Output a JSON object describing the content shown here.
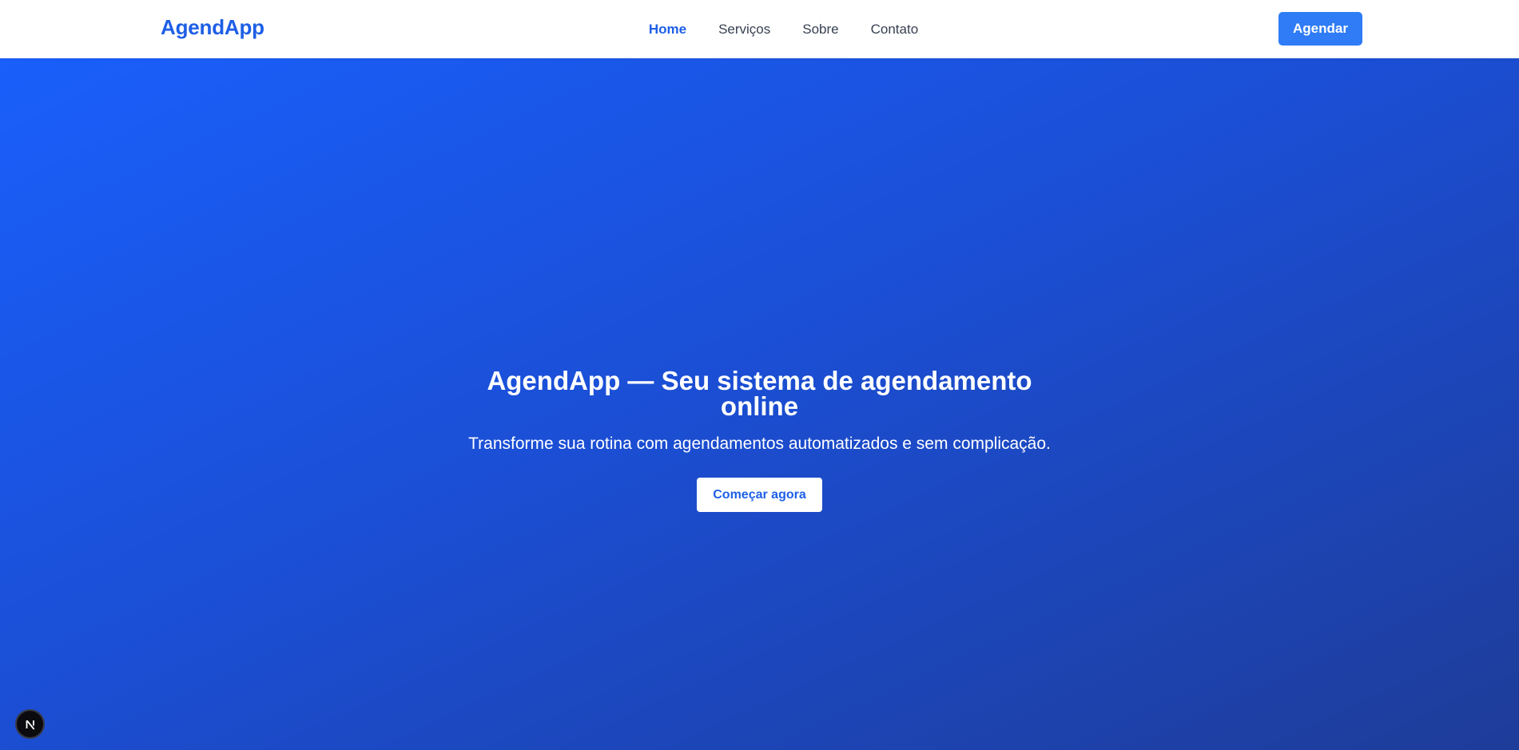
{
  "header": {
    "logo": "AgendApp",
    "nav": [
      {
        "label": "Home",
        "active": true
      },
      {
        "label": "Serviços",
        "active": false
      },
      {
        "label": "Sobre",
        "active": false
      },
      {
        "label": "Contato",
        "active": false
      }
    ],
    "cta_label": "Agendar"
  },
  "hero": {
    "title_line1": "AgendApp — Seu sistema de agendamento",
    "title_line2": "online",
    "subtitle": "Transforme sua rotina com agendamentos automatizados e sem complicação.",
    "button_label": "Começar agora"
  },
  "badge": {
    "icon": "nextjs-logo-icon"
  },
  "colors": {
    "brand": "#1d5fe6",
    "cta": "#2f7cf6",
    "hero_gradient_start": "#1a5ffb",
    "hero_gradient_end": "#1e3c99"
  }
}
